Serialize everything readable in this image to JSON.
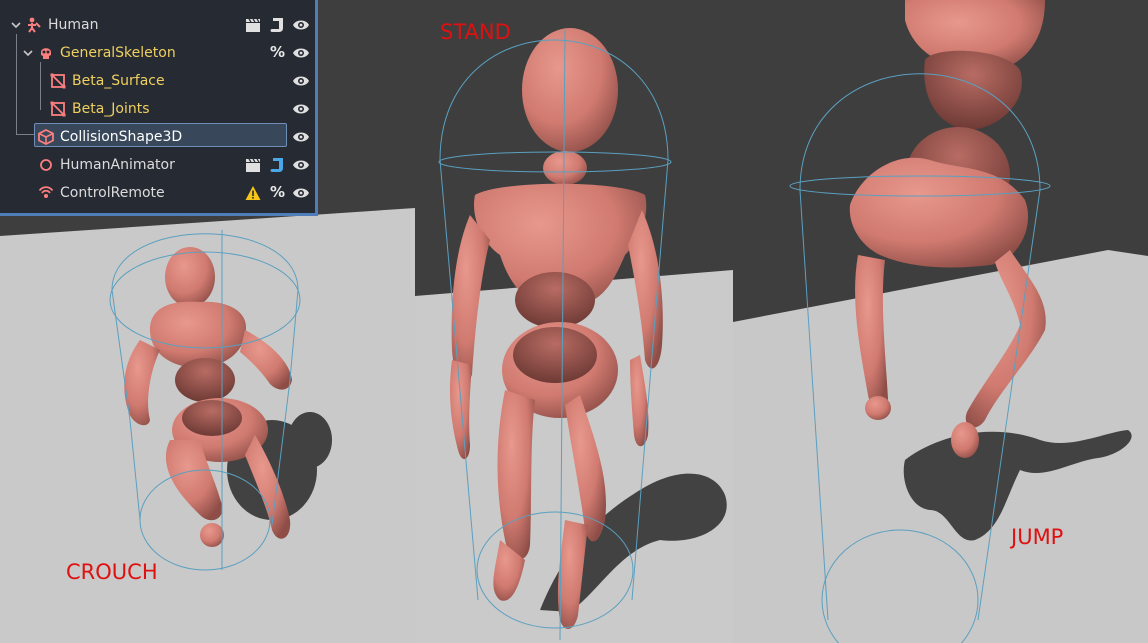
{
  "scene_tree": {
    "nodes": [
      {
        "name": "Human",
        "depth": 0,
        "color": "#dcdcdc",
        "icon": "skeleton-root-icon",
        "expanded": true,
        "actions": [
          "clapperboard-icon",
          "script-icon",
          "visibility-icon"
        ]
      },
      {
        "name": "GeneralSkeleton",
        "depth": 1,
        "color": "#f0d060",
        "icon": "skull-icon",
        "expanded": true,
        "actions": [
          "unique-name-icon",
          "visibility-icon"
        ]
      },
      {
        "name": "Beta_Surface",
        "depth": 2,
        "color": "#f0d060",
        "icon": "mesh-icon",
        "actions": [
          "visibility-icon"
        ]
      },
      {
        "name": "Beta_Joints",
        "depth": 2,
        "color": "#f0d060",
        "icon": "mesh-icon",
        "actions": [
          "visibility-icon"
        ]
      },
      {
        "name": "CollisionShape3D",
        "depth": 1,
        "color": "#ffffff",
        "icon": "collision-shape-icon",
        "selected": true,
        "actions": [
          "visibility-icon"
        ]
      },
      {
        "name": "HumanAnimator",
        "depth": 1,
        "color": "#dcdcdc",
        "icon": "node-circle-icon",
        "actions": [
          "clapperboard-icon",
          "script-icon",
          "visibility-icon"
        ]
      },
      {
        "name": "ControlRemote",
        "depth": 1,
        "color": "#dcdcdc",
        "icon": "remote-signal-icon",
        "actions": [
          "warning-icon",
          "unique-name-icon",
          "visibility-icon"
        ]
      }
    ],
    "unique_symbol": "%",
    "accent_color": "#4e7dba",
    "icon_color": "#fc7f7f"
  },
  "viewport": {
    "labels": {
      "stand": "STAND",
      "crouch": "CROUCH",
      "jump": "JUMP"
    },
    "label_color": "#e01010",
    "figure_color": "#d9887f",
    "capsule_color": "#5aa0c0"
  }
}
